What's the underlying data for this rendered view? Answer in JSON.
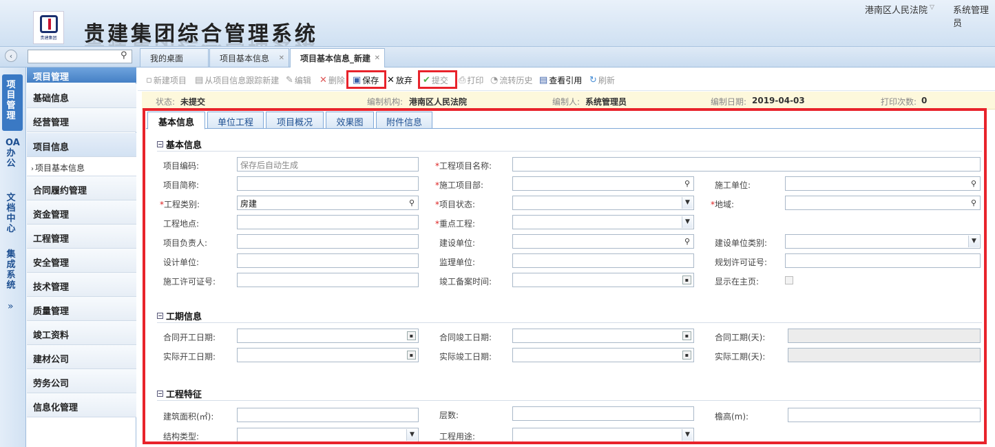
{
  "header": {
    "title": "贵建集团综合管理系统",
    "logo_text": "贵建集团",
    "org": "港南区人民法院",
    "user": "系统管理员"
  },
  "page_tabs": [
    {
      "label": "我的桌面"
    },
    {
      "label": "项目基本信息"
    },
    {
      "label": "项目基本信息_新建"
    }
  ],
  "vnav": [
    {
      "label": "项目管理"
    },
    {
      "label": "OA办公"
    },
    {
      "label": "文档中心"
    },
    {
      "label": "集成系统"
    }
  ],
  "sidebar": {
    "header": "项目管理",
    "items": [
      {
        "label": "基础信息"
      },
      {
        "label": "经营管理"
      },
      {
        "label": "项目信息"
      },
      {
        "label": "合同履约管理"
      },
      {
        "label": "资金管理"
      },
      {
        "label": "工程管理"
      },
      {
        "label": "安全管理"
      },
      {
        "label": "技术管理"
      },
      {
        "label": "质量管理"
      },
      {
        "label": "竣工资料"
      },
      {
        "label": "建材公司"
      },
      {
        "label": "劳务公司"
      },
      {
        "label": "信息化管理"
      }
    ],
    "sub_item": "项目基本信息"
  },
  "toolbar": {
    "new": "新建项目",
    "new_from_track": "从项目信息跟踪新建",
    "edit": "编辑",
    "delete": "删除",
    "save": "保存",
    "abandon": "放弃",
    "submit": "提交",
    "print": "打印",
    "history": "流转历史",
    "view_ref": "查看引用",
    "refresh": "刷新"
  },
  "info_bar": {
    "status_label": "状态:",
    "status": "未提交",
    "org_label": "编制机构:",
    "org": "港南区人民法院",
    "author_label": "编制人:",
    "author": "系统管理员",
    "date_label": "编制日期:",
    "date": "2019-04-03",
    "print_label": "打印次数:",
    "print_count": "0"
  },
  "form_tabs": [
    {
      "label": "基本信息"
    },
    {
      "label": "单位工程"
    },
    {
      "label": "项目概况"
    },
    {
      "label": "效果图"
    },
    {
      "label": "附件信息"
    }
  ],
  "sections": {
    "basic": "基本信息",
    "period": "工期信息",
    "feature": "工程特征"
  },
  "fields": {
    "code": {
      "label": "项目编码:",
      "placeholder": "保存后自动生成"
    },
    "name": {
      "label": "工程项目名称:"
    },
    "short": {
      "label": "项目简称:"
    },
    "dept": {
      "label": "施工项目部:"
    },
    "unit": {
      "label": "施工单位:"
    },
    "category": {
      "label": "工程类别:",
      "value": "房建"
    },
    "status": {
      "label": "项目状态:"
    },
    "region": {
      "label": "地域:"
    },
    "location": {
      "label": "工程地点:"
    },
    "key": {
      "label": "重点工程:"
    },
    "manager": {
      "label": "项目负责人:"
    },
    "builder": {
      "label": "建设单位:"
    },
    "builder_type": {
      "label": "建设单位类别:"
    },
    "designer": {
      "label": "设计单位:"
    },
    "supervisor": {
      "label": "监理单位:"
    },
    "plan_permit": {
      "label": "规划许可证号:"
    },
    "build_permit": {
      "label": "施工许可证号:"
    },
    "record_date": {
      "label": "竣工备案时间:"
    },
    "show_home": {
      "label": "显示在主页:"
    },
    "c_start": {
      "label": "合同开工日期:"
    },
    "c_end": {
      "label": "合同竣工日期:"
    },
    "c_days": {
      "label": "合同工期(天):"
    },
    "a_start": {
      "label": "实际开工日期:"
    },
    "a_end": {
      "label": "实际竣工日期:"
    },
    "a_days": {
      "label": "实际工期(天):"
    },
    "area": {
      "label": "建筑面积(㎡):"
    },
    "floors": {
      "label": "层数:"
    },
    "eave": {
      "label": "檐高(m):"
    },
    "structure": {
      "label": "结构类型:"
    },
    "usage": {
      "label": "工程用途:"
    }
  },
  "colors": {
    "accent": "#3a79c4",
    "highlight": "#e8232b",
    "required": "#dd2222"
  }
}
